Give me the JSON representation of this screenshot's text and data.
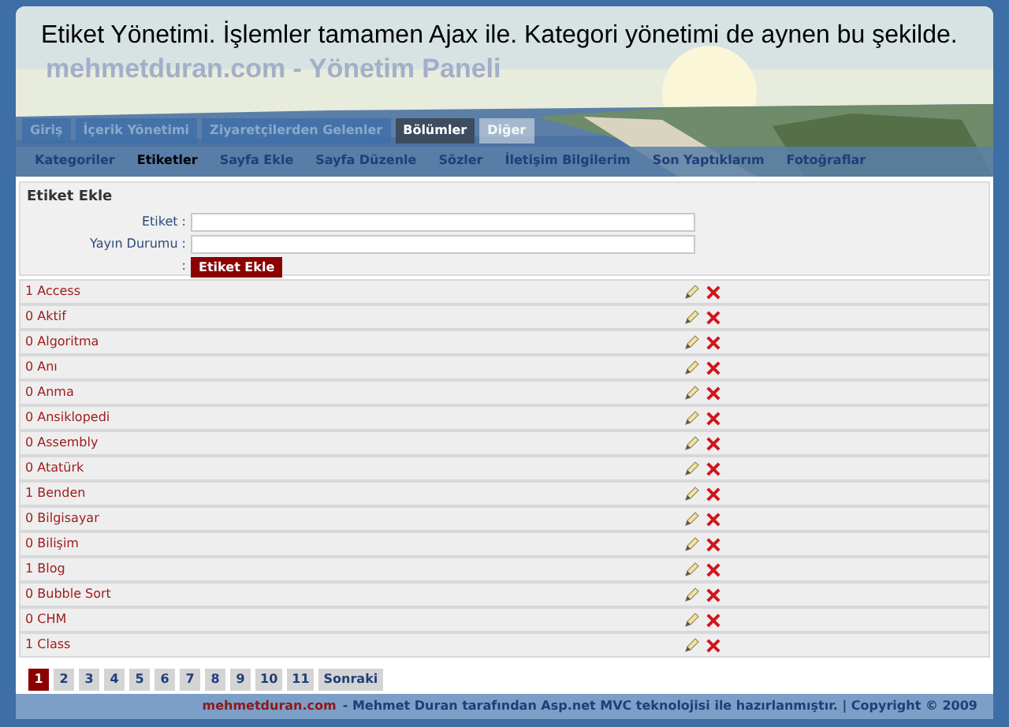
{
  "header": {
    "caption": "Etiket Yönetimi. İşlemler tamamen Ajax ile. Kategori yönetimi de aynen bu şekilde.",
    "site_title": "mehmetduran.com - Yönetim Paneli"
  },
  "main_nav": [
    {
      "label": "Giriş",
      "selected": false
    },
    {
      "label": "İçerik Yönetimi",
      "selected": false
    },
    {
      "label": "Ziyaretçilerden Gelenler",
      "selected": false
    },
    {
      "label": "Bölümler",
      "selected": true
    },
    {
      "label": "Diğer",
      "selected": false
    }
  ],
  "sub_nav": [
    {
      "label": "Kategoriler",
      "selected": false
    },
    {
      "label": "Etiketler",
      "selected": true
    },
    {
      "label": "Sayfa Ekle",
      "selected": false
    },
    {
      "label": "Sayfa Düzenle",
      "selected": false
    },
    {
      "label": "Sözler",
      "selected": false
    },
    {
      "label": "İletişim Bilgilerim",
      "selected": false
    },
    {
      "label": "Son Yaptıklarım",
      "selected": false
    },
    {
      "label": "Fotoğraflar",
      "selected": false
    }
  ],
  "form": {
    "title": "Etiket Ekle",
    "fields": [
      {
        "label": "Etiket :"
      },
      {
        "label": "Yayın Durumu :"
      }
    ],
    "button_colon": ":",
    "button": "Etiket Ekle"
  },
  "tags": [
    {
      "label": "1 Access"
    },
    {
      "label": "0 Aktif"
    },
    {
      "label": "0 Algoritma"
    },
    {
      "label": "0 Anı"
    },
    {
      "label": "0 Anma"
    },
    {
      "label": "0 Ansiklopedi"
    },
    {
      "label": "0 Assembly"
    },
    {
      "label": "0 Atatürk"
    },
    {
      "label": "1 Benden"
    },
    {
      "label": "0 Bilgisayar"
    },
    {
      "label": "0 Bilişim"
    },
    {
      "label": "1 Blog"
    },
    {
      "label": "0 Bubble Sort"
    },
    {
      "label": "0 CHM"
    },
    {
      "label": "1 Class"
    }
  ],
  "pagination": [
    {
      "label": "1",
      "selected": true
    },
    {
      "label": "2",
      "selected": false
    },
    {
      "label": "3",
      "selected": false
    },
    {
      "label": "4",
      "selected": false
    },
    {
      "label": "5",
      "selected": false
    },
    {
      "label": "6",
      "selected": false
    },
    {
      "label": "7",
      "selected": false
    },
    {
      "label": "8",
      "selected": false
    },
    {
      "label": "9",
      "selected": false
    },
    {
      "label": "10",
      "selected": false
    },
    {
      "label": "11",
      "selected": false
    },
    {
      "label": "Sonraki",
      "selected": false
    }
  ],
  "footer": {
    "link": "mehmetduran.com",
    "text": "- Mehmet Duran tarafından Asp.net MVC teknolojisi ile hazırlanmıştır. | Copyright © 2009"
  }
}
